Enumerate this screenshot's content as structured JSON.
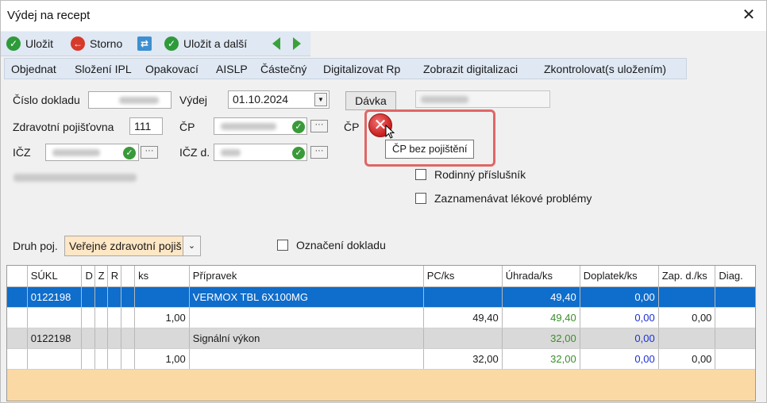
{
  "window": {
    "title": "Výdej na recept",
    "close_glyph": "✕"
  },
  "toolbar": {
    "save_label": "Uložit",
    "cancel_label": "Storno",
    "save_next_label": "Uložit a další",
    "refresh_icon": "refresh-icon",
    "prev_icon": "arrow-left-icon",
    "next_icon": "arrow-right-icon"
  },
  "menu": {
    "items": [
      "Objednat",
      "Složení IPL",
      "Opakovací",
      "AISLP",
      "Částečný",
      "Digitalizovat Rp",
      "Zobrazit digitalizaci",
      "Zkontrolovat(s uložením)"
    ]
  },
  "form": {
    "cislo_dokladu_label": "Číslo dokladu",
    "vydej_label": "Výdej",
    "vydej_value": "01.10.2024",
    "davka_button": "Dávka",
    "pojistovna_label": "Zdravotní pojišťovna",
    "pojistovna_value": "111",
    "cp_label": "ČP",
    "cp2_label": "ČP",
    "icz_label": "IČZ",
    "icz_d_label": "IČZ d.",
    "dots": "···",
    "rodinny_label": "Rodinný příslušník",
    "zaznamenavat_label": "Zaznamenávat lékové problémy",
    "druh_poj_label": "Druh poj.",
    "druh_poj_value": "Veřejné zdravotní pojiš",
    "oznaceni_label": "Označení dokladu"
  },
  "tooltip": {
    "text": "ČP bez pojištění"
  },
  "colors": {
    "accent_blue": "#0f6dcb",
    "error_red": "#c81d1d",
    "toolbar_bg": "#dfe8f3",
    "grid_footer": "#fbd9a5"
  },
  "grid": {
    "columns": [
      "",
      "SÚKL",
      "D",
      "Z",
      "R",
      "",
      "ks",
      "Přípravek",
      "PC/ks",
      "Úhrada/ks",
      "Doplatek/ks",
      "Zap. d./ks",
      "Diag."
    ],
    "rows": [
      {
        "style": "sel",
        "cells": [
          "",
          "0122198",
          "",
          "",
          "",
          "",
          "",
          "VERMOX TBL 6X100MG",
          "",
          "49,40",
          "0,00",
          "",
          ""
        ]
      },
      {
        "style": "white",
        "cells": [
          "",
          "",
          "",
          "",
          "",
          "",
          "1,00",
          "",
          "49,40",
          "49,40",
          "0,00",
          "0,00",
          ""
        ]
      },
      {
        "style": "gray",
        "cells": [
          "",
          "0122198",
          "",
          "",
          "",
          "",
          "",
          "Signální výkon",
          "",
          "32,00",
          "0,00",
          "",
          ""
        ]
      },
      {
        "style": "white",
        "cells": [
          "",
          "",
          "",
          "",
          "",
          "",
          "1,00",
          "",
          "32,00",
          "32,00",
          "0,00",
          "0,00",
          ""
        ]
      }
    ]
  }
}
